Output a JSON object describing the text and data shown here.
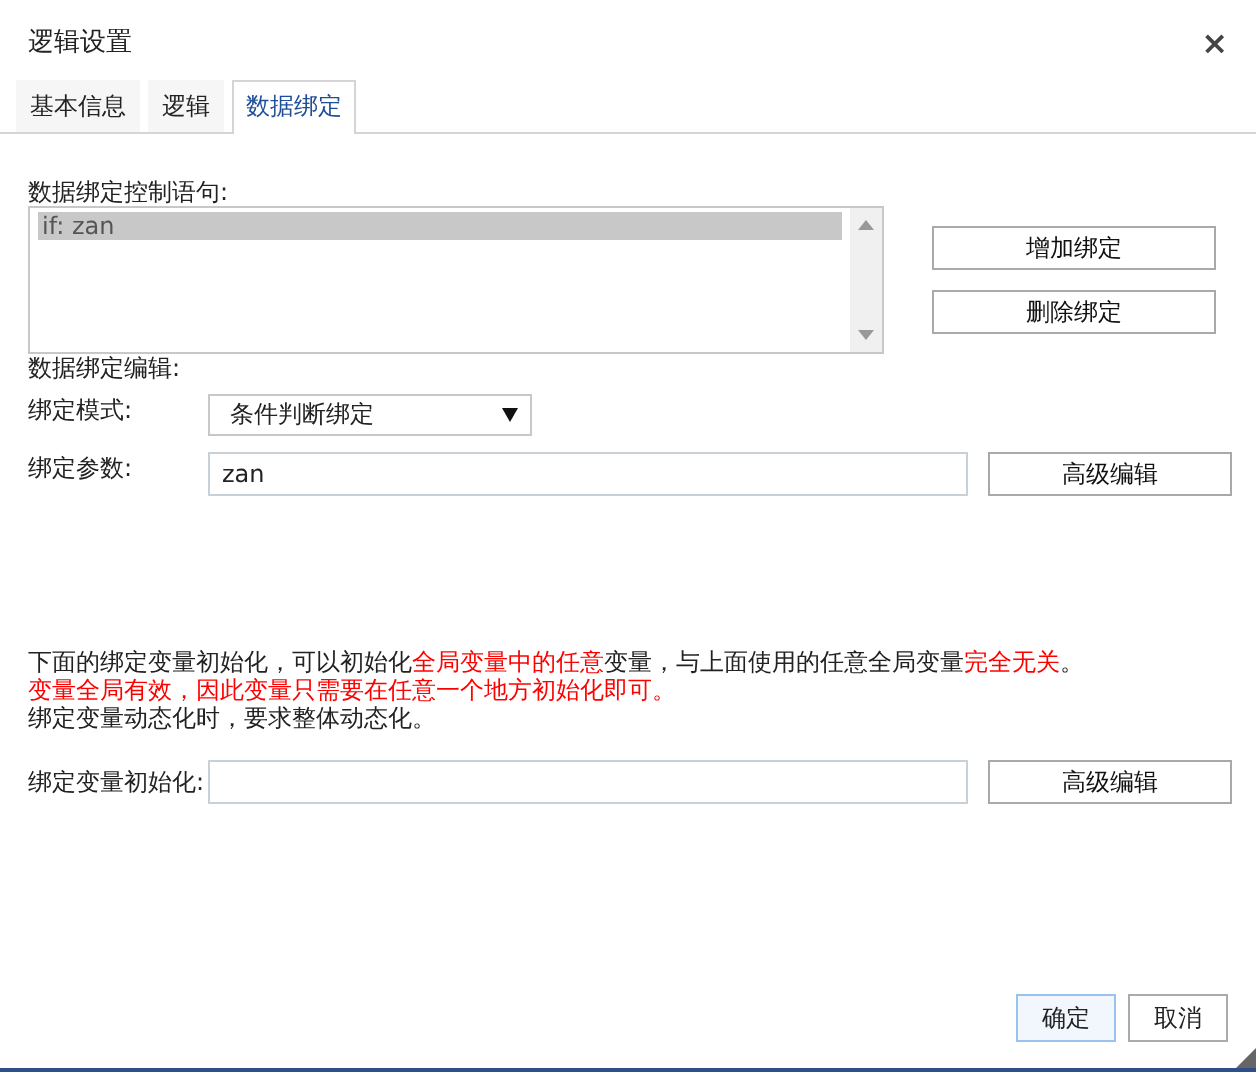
{
  "window": {
    "title": "逻辑设置",
    "close": "×"
  },
  "tabs": [
    {
      "label": "基本信息",
      "selected": false
    },
    {
      "label": "逻辑",
      "selected": false
    },
    {
      "label": "数据绑定",
      "selected": true
    }
  ],
  "statements": {
    "label": "数据绑定控制语句:",
    "items": [
      {
        "text": "if: zan",
        "selected": true
      }
    ]
  },
  "statement_buttons": [
    "增加绑定",
    "删除绑定"
  ],
  "editor": {
    "label": "数据绑定编辑:",
    "mode": {
      "label": "绑定模式:",
      "value": "条件判断绑定"
    },
    "params": {
      "label": "绑定参数:",
      "value": "zan",
      "button": "高级编辑"
    }
  },
  "notes": [
    [
      {
        "text": "下面的绑定变量初始化，可以初始化",
        "emphasis": false
      },
      {
        "text": "全局变量中的任意",
        "emphasis": true
      },
      {
        "text": "变量，与上面使用的任意全局变量",
        "emphasis": false
      },
      {
        "text": "完全无关",
        "emphasis": true
      },
      {
        "text": "。",
        "emphasis": false
      }
    ],
    [
      {
        "text": "变量全局有效，因此变量只需要在任意一个地方初始化即可。",
        "emphasis": true
      }
    ],
    [
      {
        "text": "绑定变量动态化时，要求整体动态化。",
        "emphasis": false
      }
    ]
  ],
  "init": {
    "label": "绑定变量初始化:",
    "button": "高级编辑"
  },
  "footer_buttons": [
    {
      "label": "确定",
      "primary": true
    },
    {
      "label": "取消",
      "primary": false
    }
  ]
}
